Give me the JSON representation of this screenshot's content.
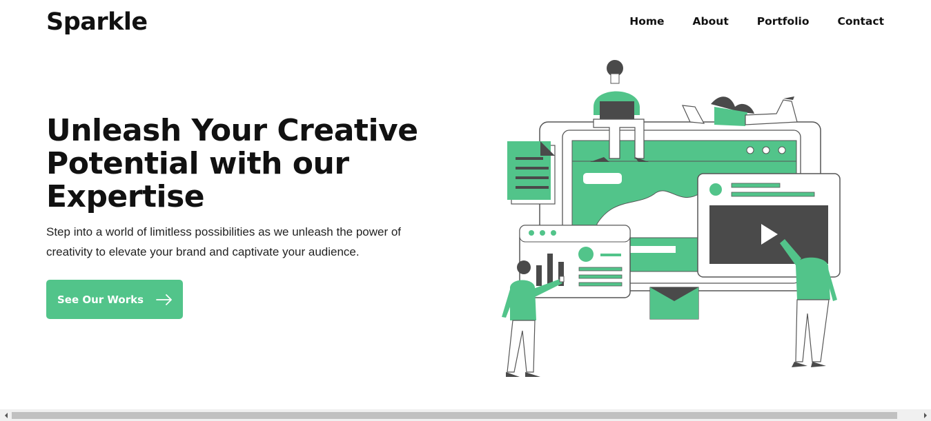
{
  "header": {
    "logo": "Sparkle",
    "nav": [
      {
        "label": "Home"
      },
      {
        "label": "About"
      },
      {
        "label": "Portfolio"
      },
      {
        "label": "Contact"
      }
    ]
  },
  "hero": {
    "title": "Unleash Your Creative Potential with our Expertise",
    "subtitle": "Step into a world of limitless possibilities as we unleash the power of creativity to elevate your brand and captivate your audience.",
    "cta_label": "See Our Works",
    "cta_icon": "arrow-right-icon"
  },
  "illustration": {
    "icon": "creative-team-illustration",
    "accent_color": "#52c48a",
    "dark_color": "#4a4a4a"
  },
  "colors": {
    "accent": "#52c48a",
    "text": "#111111"
  },
  "scrollbar": {
    "orientation": "horizontal"
  }
}
